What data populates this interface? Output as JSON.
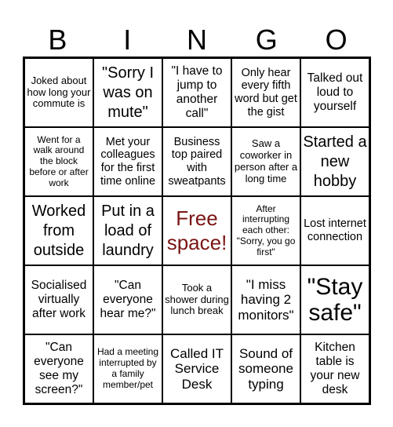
{
  "header": {
    "letters": [
      "B",
      "I",
      "N",
      "G",
      "O"
    ]
  },
  "colors": {
    "free_space": "#7a1515",
    "grid_line": "#000000",
    "background": "#ffffff"
  },
  "cells": [
    [
      "Joked about how long your commute is",
      "\"Sorry I was on mute\"",
      "\"I have to jump to another call\"",
      "Only hear every fifth word but get the gist",
      "Talked out loud to yourself"
    ],
    [
      "Went for a walk around the block before or after work",
      "Met your colleagues for the first time online",
      "Business top paired with sweatpants",
      "Saw a coworker in person after a long time",
      "Started a new hobby"
    ],
    [
      "Worked from outside",
      "Put in a load of laundry",
      "Free space!",
      "After interrupting each other: \"Sorry, you go first\"",
      "Lost internet connection"
    ],
    [
      "Socialised virtually after work",
      "\"Can everyone hear me?\"",
      "Took a shower during lunch break",
      "\"I miss having 2 monitors\"",
      "\"Stay safe\""
    ],
    [
      "\"Can everyone see my screen?\"",
      "Had a meeting interrupted by a family member/pet",
      "Called IT Service Desk",
      "Sound of someone typing",
      "Kitchen table is your new desk"
    ]
  ]
}
